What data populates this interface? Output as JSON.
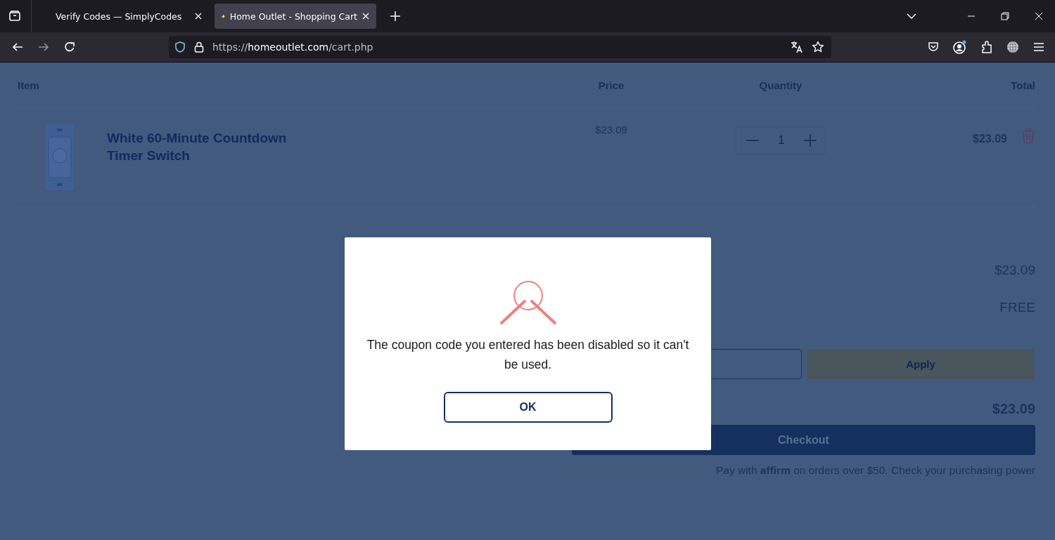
{
  "browser": {
    "tabs": [
      {
        "title": "Verify Codes — SimplyCodes",
        "selected": false
      },
      {
        "title": "Home Outlet - Shopping Cart",
        "selected": true
      }
    ],
    "url": {
      "scheme": "https://",
      "host": "homeoutlet.com",
      "path": "/cart.php"
    }
  },
  "cart": {
    "columns": [
      "Item",
      "Price",
      "Quantity",
      "Total"
    ],
    "items": [
      {
        "name": "White 60-Minute Countdown Timer Switch",
        "price": "$23.09",
        "quantity": "1",
        "total": "$23.09"
      }
    ]
  },
  "summary": {
    "subtotal": "$23.09",
    "shipping": "FREE",
    "apply_label": "Apply",
    "total": "$23.09",
    "checkout_label": "Checkout",
    "financing_note": "Pay with **affirm** on orders over $50. Check your purchasing power"
  },
  "dialog": {
    "message": "The coupon code you entered has been disabled so it can't be used.",
    "button": "OK"
  }
}
